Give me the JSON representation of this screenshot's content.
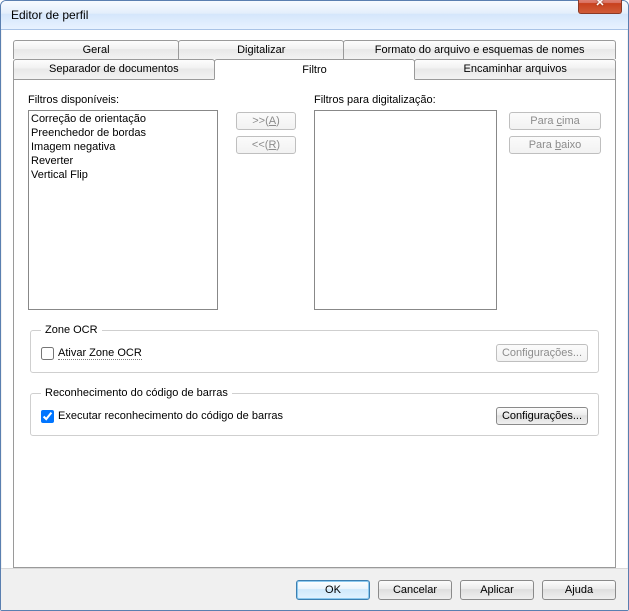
{
  "window": {
    "title": "Editor de perfil"
  },
  "tabs": {
    "row1": [
      {
        "label": "Geral"
      },
      {
        "label": "Digitalizar"
      },
      {
        "label": "Formato do arquivo e esquemas de nomes"
      }
    ],
    "row2": [
      {
        "label": "Separador de documentos"
      },
      {
        "label": "Filtro",
        "active": true
      },
      {
        "label": "Encaminhar arquivos"
      }
    ]
  },
  "filters": {
    "available_label": "Filtros disponíveis:",
    "scan_label": "Filtros para digitalização:",
    "available_items": [
      "Correção de orientação",
      "Preenchedor de bordas",
      "Imagem negativa",
      "Reverter",
      "Vertical Flip"
    ],
    "scan_items": [],
    "btn_add_prefix": ">>(",
    "btn_add_key": "A",
    "btn_add_suffix": ")",
    "btn_remove_prefix": "<<(",
    "btn_remove_key": "R",
    "btn_remove_suffix": ")",
    "btn_up_prefix": "Para ",
    "btn_up_key": "c",
    "btn_up_suffix": "ima",
    "btn_down_prefix": "Para ",
    "btn_down_key": "b",
    "btn_down_suffix": "aixo"
  },
  "zone_ocr": {
    "legend": "Zone OCR",
    "checkbox_prefix": "A",
    "checkbox_key": "t",
    "checkbox_suffix": "ivar Zone OCR",
    "checked": false,
    "config_btn": "Configurações..."
  },
  "barcode": {
    "legend": "Reconhecimento do código de barras",
    "checkbox_prefix": "",
    "checkbox_key": "E",
    "checkbox_suffix": "xecutar reconhecimento do código de barras",
    "checked": true,
    "config_btn": "Configurações..."
  },
  "actions": {
    "ok": "OK",
    "cancel": "Cancelar",
    "apply": "Aplicar",
    "help": "Ajuda"
  }
}
